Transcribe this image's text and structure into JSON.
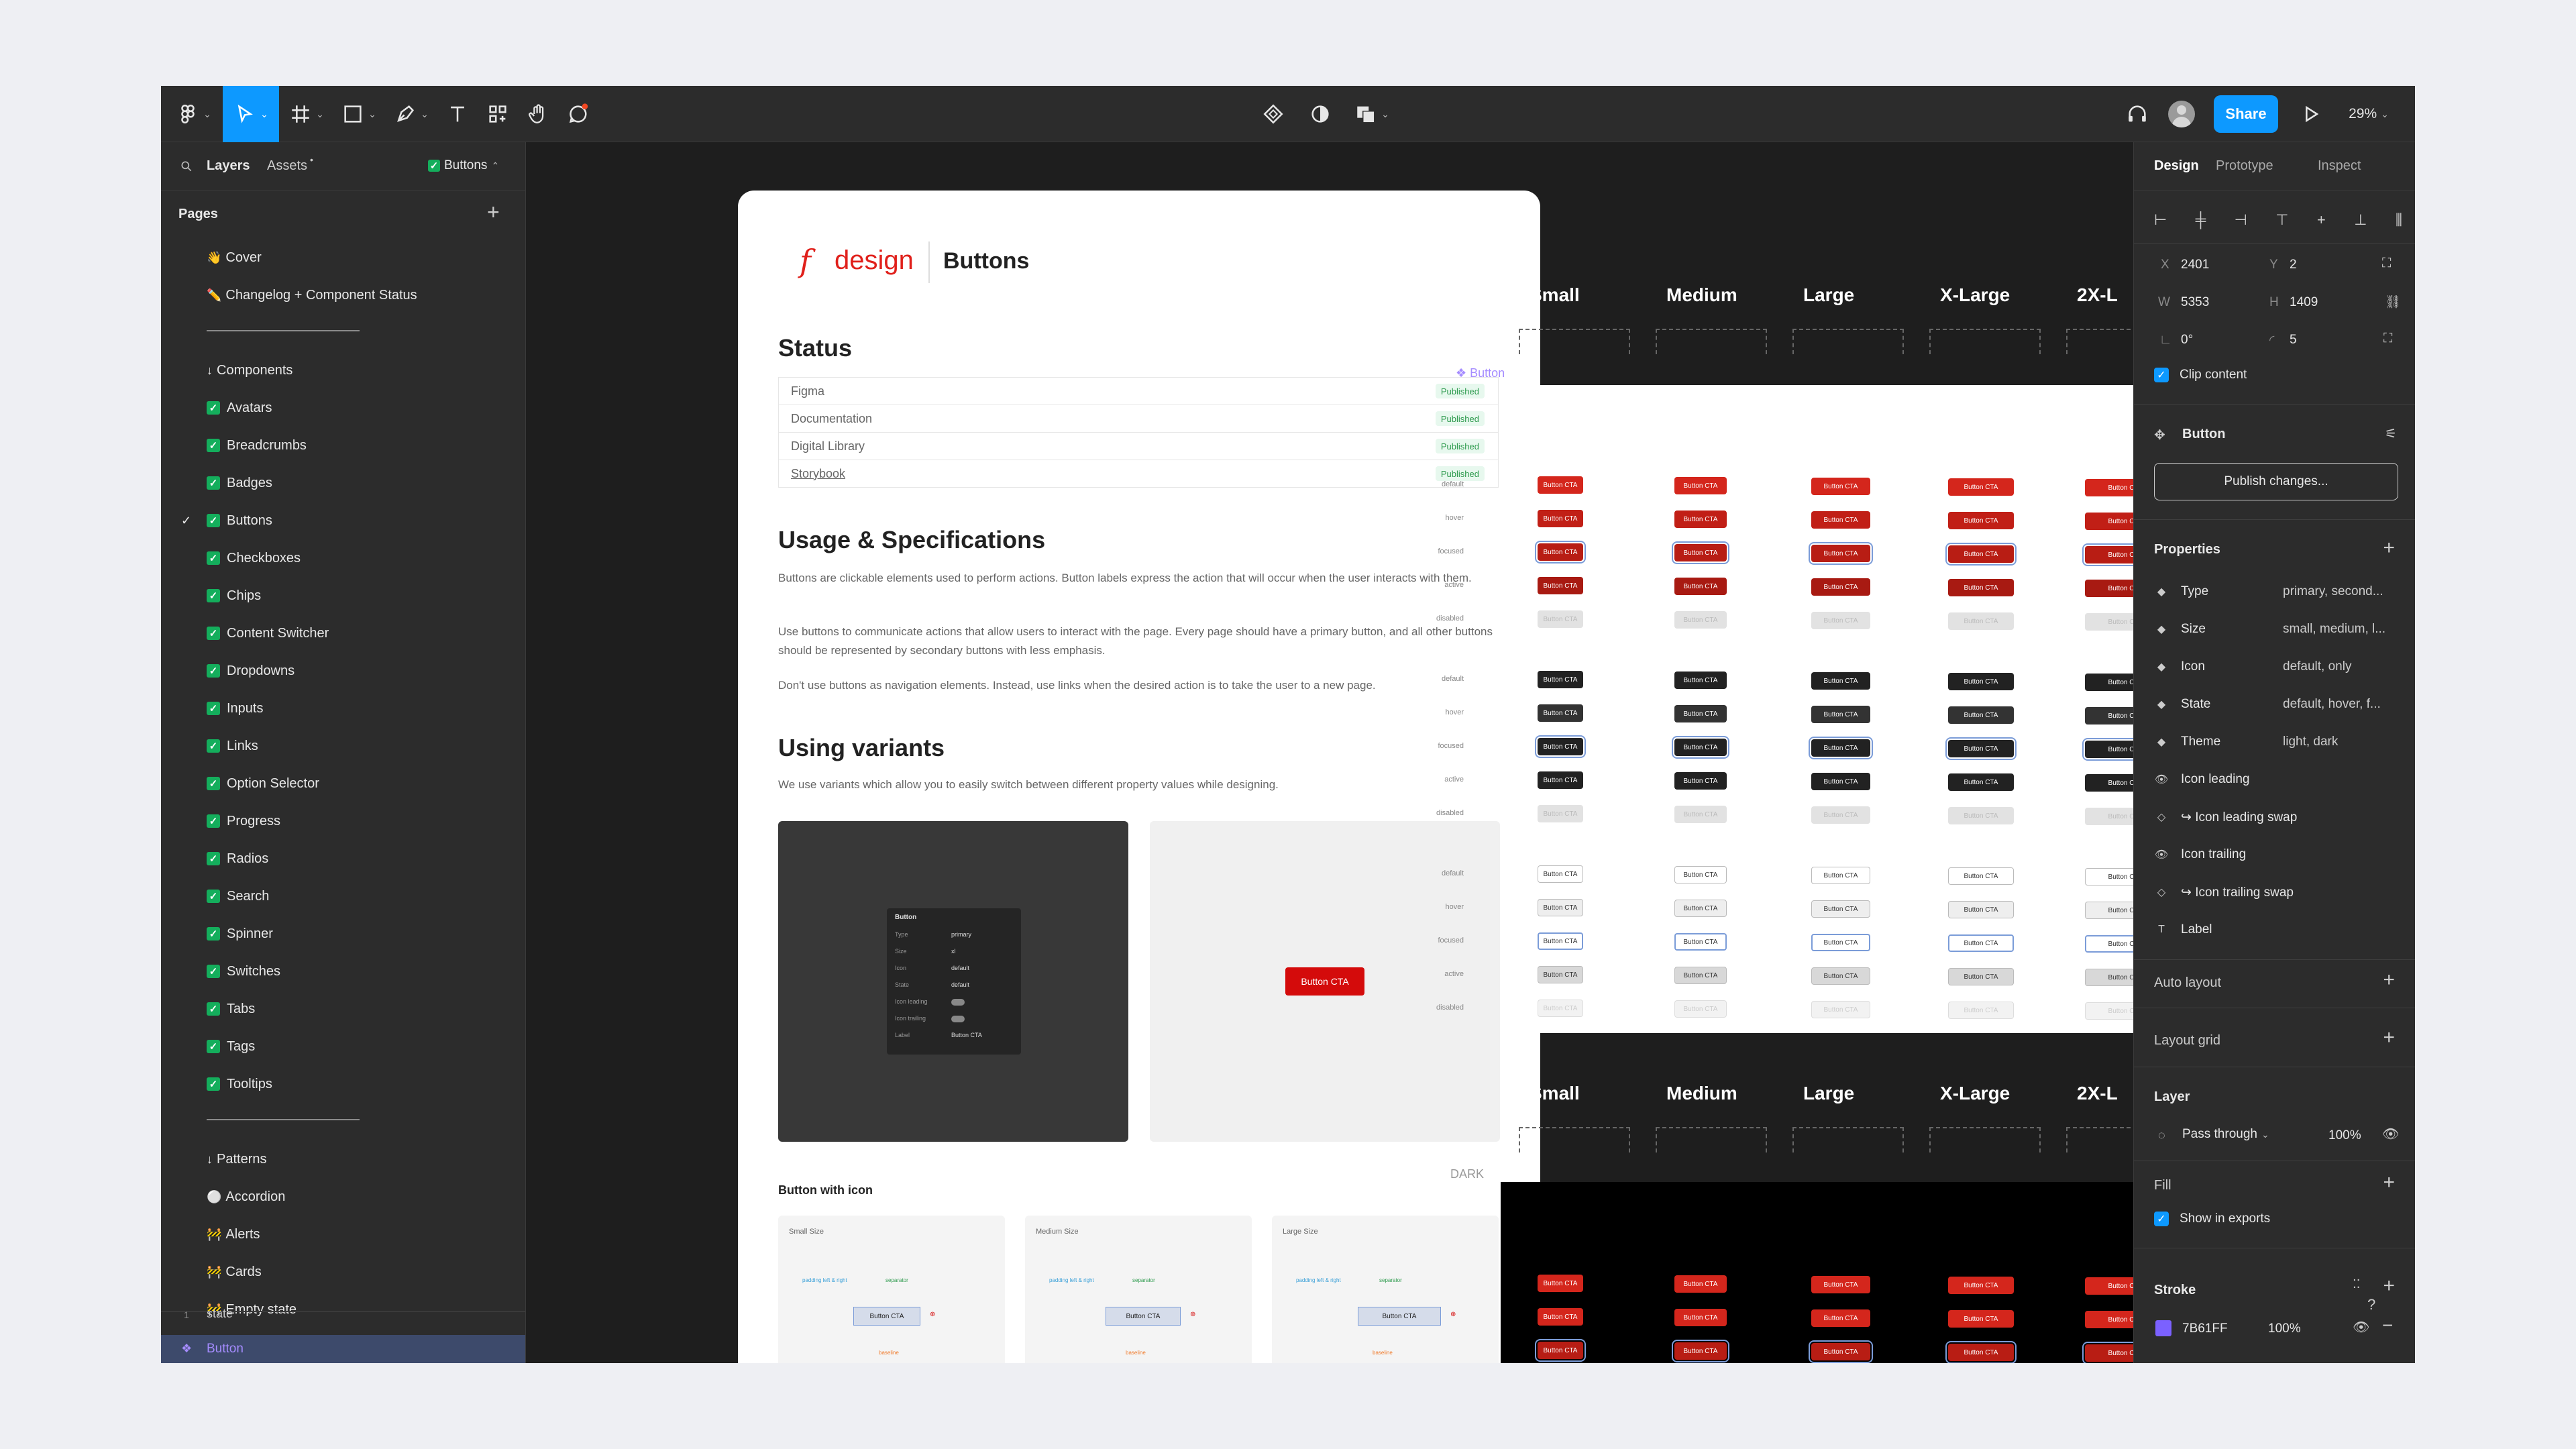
{
  "toolbar": {
    "share_label": "Share",
    "zoom": "29%"
  },
  "left_panel": {
    "tab_layers": "Layers",
    "tab_assets": "Assets",
    "page_chip": "Buttons",
    "pages_title": "Pages",
    "pages": [
      {
        "label": "Cover",
        "prefix": "👋",
        "type": "emoji"
      },
      {
        "label": "Changelog + Component Status",
        "prefix": "✏️",
        "type": "emoji"
      },
      {
        "type": "sep"
      },
      {
        "label": "Components",
        "prefix": "↓",
        "type": "text"
      },
      {
        "label": "Avatars",
        "type": "check"
      },
      {
        "label": "Breadcrumbs",
        "type": "check"
      },
      {
        "label": "Badges",
        "type": "check"
      },
      {
        "label": "Buttons",
        "type": "check",
        "current": true
      },
      {
        "label": "Checkboxes",
        "type": "check"
      },
      {
        "label": "Chips",
        "type": "check"
      },
      {
        "label": "Content Switcher",
        "type": "check"
      },
      {
        "label": "Dropdowns",
        "type": "check"
      },
      {
        "label": "Inputs",
        "type": "check"
      },
      {
        "label": "Links",
        "type": "check"
      },
      {
        "label": "Option Selector",
        "type": "check"
      },
      {
        "label": "Progress",
        "type": "check"
      },
      {
        "label": "Radios",
        "type": "check"
      },
      {
        "label": "Search",
        "type": "check"
      },
      {
        "label": "Spinner",
        "type": "check"
      },
      {
        "label": "Switches",
        "type": "check"
      },
      {
        "label": "Tabs",
        "type": "check"
      },
      {
        "label": "Tags",
        "type": "check"
      },
      {
        "label": "Tooltips",
        "type": "check"
      },
      {
        "type": "sep"
      },
      {
        "label": "Patterns",
        "prefix": "↓",
        "type": "text"
      },
      {
        "label": "Accordion",
        "prefix": "⚪",
        "type": "emoji"
      },
      {
        "label": "Alerts",
        "prefix": "🚧",
        "type": "emoji"
      },
      {
        "label": "Cards",
        "prefix": "🚧",
        "type": "emoji"
      },
      {
        "label": "Empty state",
        "prefix": "🚧",
        "type": "emoji"
      }
    ],
    "layer_state": "state",
    "layer_button": "Button"
  },
  "doc": {
    "brand_mark": "f",
    "brand_word": "design",
    "title": "Buttons",
    "status_heading": "Status",
    "status_rows": [
      {
        "name": "Figma",
        "badge": "Published"
      },
      {
        "name": "Documentation",
        "badge": "Published"
      },
      {
        "name": "Digital Library",
        "badge": "Published"
      },
      {
        "name": "Storybook",
        "badge": "Published"
      }
    ],
    "usage_heading": "Usage & Specifications",
    "p1": "Buttons are clickable elements used to perform actions. Button labels express the action that will occur when the user interacts with them.",
    "p2": "Use buttons to communicate actions that allow users to interact with the page. Every page should have a primary button, and all other buttons should be represented by secondary buttons with less emphasis.",
    "p3": "Don't use buttons as navigation elements. Instead, use links when the desired action is to take the user to a new page.",
    "variants_heading": "Using variants",
    "variants_desc": "We use variants which allow you to easily switch between different property values while designing.",
    "mini_panel": {
      "title": "Button",
      "rows": [
        [
          "Type",
          "primary"
        ],
        [
          "Size",
          "xl"
        ],
        [
          "Icon",
          "default"
        ],
        [
          "State",
          "default"
        ],
        [
          "Icon leading",
          ""
        ],
        [
          "Icon trailing",
          ""
        ],
        [
          "Label",
          "Button CTA"
        ]
      ]
    },
    "demo_button": "Button CTA",
    "button_with_icon": "Button with icon",
    "size_cards": [
      {
        "label": "Small Size",
        "btn": "Button CTA"
      },
      {
        "label": "Medium Size",
        "btn": "Button CTA"
      },
      {
        "label": "Large Size",
        "btn": "Button CTA"
      }
    ],
    "spec_note1": "padding left & right",
    "spec_note2": "separator",
    "spec_note3": "baseline"
  },
  "canvas": {
    "sizes": [
      "Small",
      "Medium",
      "Large",
      "X-Large",
      "2X-L"
    ],
    "frame_label": "Button",
    "dark_label": "DARK",
    "states": [
      "default",
      "hover",
      "focused",
      "active",
      "disabled"
    ],
    "cta": "Button CTA",
    "cta_short": "Button C"
  },
  "right_panel": {
    "tabs": [
      "Design",
      "Prototype",
      "Inspect"
    ],
    "x_label": "X",
    "x": "2401",
    "y_label": "Y",
    "y": "2",
    "w_label": "W",
    "w": "5353",
    "h_label": "H",
    "h": "1409",
    "rotation": "0°",
    "radius": "5",
    "clip_content": "Clip content",
    "component_name": "Button",
    "publish": "Publish changes...",
    "properties_title": "Properties",
    "properties": [
      {
        "icon": "◆",
        "name": "Type",
        "value": "primary, second..."
      },
      {
        "icon": "◆",
        "name": "Size",
        "value": "small, medium, l..."
      },
      {
        "icon": "◆",
        "name": "Icon",
        "value": "default, only"
      },
      {
        "icon": "◆",
        "name": "State",
        "value": "default, hover, f..."
      },
      {
        "icon": "◆",
        "name": "Theme",
        "value": "light, dark"
      },
      {
        "icon": "👁",
        "name": "Icon leading",
        "value": ""
      },
      {
        "icon": "◇",
        "name": "↪ Icon leading swap",
        "value": ""
      },
      {
        "icon": "👁",
        "name": "Icon trailing",
        "value": ""
      },
      {
        "icon": "◇",
        "name": "↪ Icon trailing swap",
        "value": ""
      },
      {
        "icon": "T",
        "name": "Label",
        "value": ""
      }
    ],
    "auto_layout": "Auto layout",
    "layout_grid": "Layout grid",
    "layer_title": "Layer",
    "blend": "Pass through",
    "opacity": "100%",
    "fill_title": "Fill",
    "show_exports": "Show in exports",
    "stroke_title": "Stroke",
    "stroke_hex": "7B61FF",
    "stroke_opacity": "100%",
    "stroke_color": "#7b61ff"
  }
}
